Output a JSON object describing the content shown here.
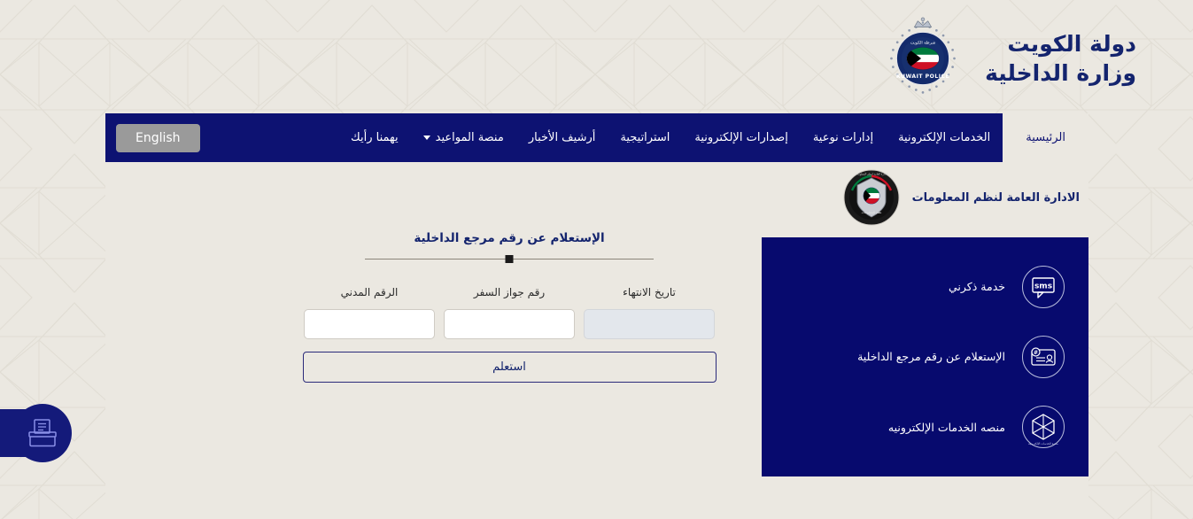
{
  "header": {
    "country_line": "دولة الكويت",
    "ministry_line": "وزارة الداخلية",
    "emblem_name": "kuwait-police-emblem",
    "emblem_text_en": "KUWAIT POLICE",
    "emblem_text_ar": "شرطة الكويت"
  },
  "nav": {
    "items": [
      {
        "label": "الرئيسية",
        "active": true,
        "dropdown": false
      },
      {
        "label": "الخدمات الإلكترونية",
        "active": false,
        "dropdown": false
      },
      {
        "label": "إدارات نوعية",
        "active": false,
        "dropdown": false
      },
      {
        "label": "إصدارات الإلكترونية",
        "active": false,
        "dropdown": false
      },
      {
        "label": "استراتيجية",
        "active": false,
        "dropdown": false
      },
      {
        "label": "أرشيف الأخبار",
        "active": false,
        "dropdown": false
      },
      {
        "label": "منصة المواعيد",
        "active": false,
        "dropdown": true
      },
      {
        "label": "يهمنا رأيك",
        "active": false,
        "dropdown": false
      }
    ],
    "language_button": "English"
  },
  "department": {
    "title": "الادارة العامة لنظم المعلومات",
    "emblem_name": "information-systems-emblem"
  },
  "form": {
    "title": "الإستعلام عن رقم مرجع الداخلية",
    "fields": [
      {
        "label": "تاريخ الانتهاء",
        "value": "",
        "placeholder": "",
        "disabled": true,
        "name": "expiry-date-input"
      },
      {
        "label": "رقم جواز السفر",
        "value": "",
        "placeholder": "",
        "disabled": false,
        "name": "passport-number-input"
      },
      {
        "label": "الرقم المدني",
        "value": "",
        "placeholder": "",
        "disabled": false,
        "name": "civil-id-input"
      }
    ],
    "submit_label": "استعلم"
  },
  "services": {
    "items": [
      {
        "label": "خدمة ذكرني",
        "icon": "sms-reminder-icon",
        "icon_text": "sms"
      },
      {
        "label": "الإستعلام عن رقم مرجع الداخلية",
        "icon": "reference-inquiry-icon",
        "icon_text": "#"
      },
      {
        "label": "منصه الخدمات الإلكترونيه",
        "icon": "eservices-platform-icon",
        "icon_text": ""
      }
    ]
  },
  "floating_action": {
    "name": "suggestion-box-button",
    "icon": "ballot-box-icon"
  },
  "colors": {
    "navy": "#0d1272",
    "panel_navy": "#070a6e",
    "beige": "#ebe8e1",
    "brand_text": "#14246e",
    "lang_button_gray": "#9a9a9a",
    "disabled_field": "#e3e7ec"
  }
}
